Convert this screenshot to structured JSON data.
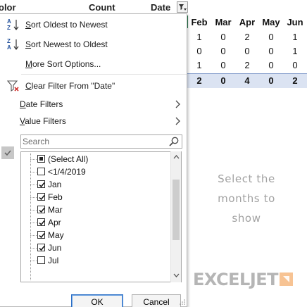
{
  "sheet": {
    "header": {
      "color_col": "olor",
      "count_col": "Count",
      "date_col": "Date"
    },
    "months": [
      "Feb",
      "Mar",
      "Apr",
      "May",
      "Jun"
    ],
    "rows": [
      [
        "1",
        "0",
        "2",
        "0",
        "1"
      ],
      [
        "0",
        "0",
        "0",
        "0",
        "1"
      ],
      [
        "1",
        "0",
        "2",
        "0",
        "0"
      ]
    ],
    "totals": [
      "2",
      "0",
      "4",
      "0",
      "2"
    ],
    "note": "Select the months to show",
    "brand": "EXCELJET"
  },
  "menu": {
    "sort_oldest": {
      "accel": "S",
      "rest": "ort Oldest to Newest",
      "icon": "sort-ascending-icon"
    },
    "sort_newest": {
      "accel": "S",
      "rest": "ort Newest to Oldest",
      "icon": "sort-descending-icon"
    },
    "more_sort": {
      "pre": "",
      "accel": "M",
      "rest": "ore Sort Options...",
      "icon": ""
    },
    "clear_filter": {
      "accel": "C",
      "rest": "lear Filter From \"Date\"",
      "icon": "clear-filter-icon"
    },
    "date_filters": {
      "accel": "D",
      "rest": "ate Filters"
    },
    "value_filters": {
      "accel": "V",
      "rest": "alue Filters"
    }
  },
  "search": {
    "placeholder": "Search"
  },
  "list": [
    {
      "label": "(Select All)",
      "state": "partial"
    },
    {
      "label": "<1/4/2019",
      "state": "unchecked"
    },
    {
      "label": "Jan",
      "state": "checked"
    },
    {
      "label": "Feb",
      "state": "checked"
    },
    {
      "label": "Mar",
      "state": "checked"
    },
    {
      "label": "Apr",
      "state": "checked"
    },
    {
      "label": "May",
      "state": "checked"
    },
    {
      "label": "Jun",
      "state": "checked"
    },
    {
      "label": "Jul",
      "state": "unchecked"
    }
  ],
  "buttons": {
    "ok": "OK",
    "cancel": "Cancel"
  },
  "colors": {
    "total_fill": "#dbe3f2",
    "accent_blue": "#2a6ec6",
    "brand_mark": "#f7c393",
    "excel_green": "#217346"
  }
}
